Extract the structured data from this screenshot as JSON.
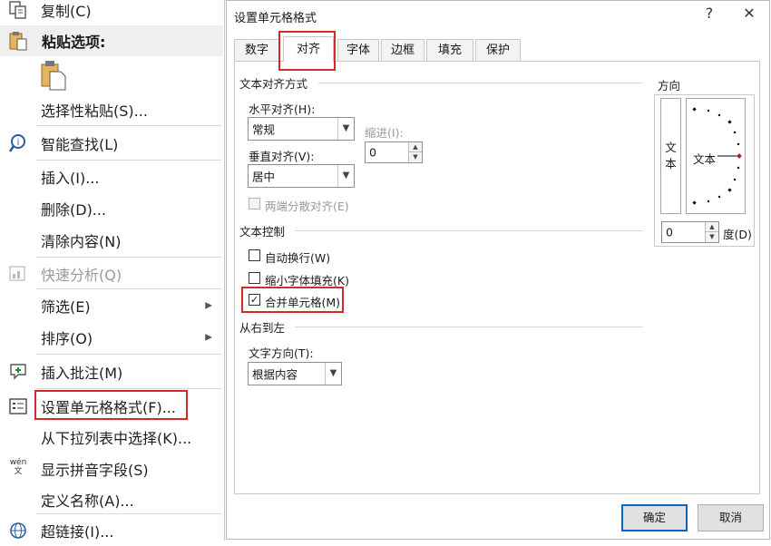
{
  "context_menu": {
    "copy": "复制(C)",
    "paste_options": "粘贴选项:",
    "paste_special": "选择性粘贴(S)...",
    "smart_lookup": "智能查找(L)",
    "insert": "插入(I)...",
    "delete": "删除(D)...",
    "clear_contents": "清除内容(N)",
    "quick_analysis": "快速分析(Q)",
    "filter": "筛选(E)",
    "sort": "排序(O)",
    "insert_comment": "插入批注(M)",
    "format_cells": "设置单元格格式(F)...",
    "pick_from_list": "从下拉列表中选择(K)...",
    "phonetic": "显示拼音字段(S)",
    "define_name": "定义名称(A)...",
    "hyperlink": "超链接(I)...",
    "phonetic_icon_text": "wén\n文"
  },
  "dialog": {
    "title": "设置单元格格式",
    "help_btn": "?",
    "close_btn": "✕",
    "tabs": [
      "数字",
      "对齐",
      "字体",
      "边框",
      "填充",
      "保护"
    ],
    "active_tab": "对齐",
    "text_alignment": {
      "section": "文本对齐方式",
      "horizontal_label": "水平对齐(H):",
      "horizontal_value": "常规",
      "indent_label": "缩进(I):",
      "indent_value": "0",
      "vertical_label": "垂直对齐(V):",
      "vertical_value": "居中",
      "justify_distributed": "两端分散对齐(E)"
    },
    "text_control": {
      "section": "文本控制",
      "wrap_text": "自动换行(W)",
      "shrink_to_fit": "缩小字体填充(K)",
      "merge_cells": "合并单元格(M)",
      "merge_checked": true
    },
    "rtl": {
      "section": "从右到左",
      "direction_label": "文字方向(T):",
      "direction_value": "根据内容"
    },
    "orientation": {
      "section": "方向",
      "vertical_text": "文\n本",
      "dial_text": "文本",
      "degree_value": "0",
      "degree_label": "度(D)"
    },
    "ok": "确定",
    "cancel": "取消"
  },
  "colors": {
    "highlight_red": "#d22b2b",
    "default_button_border": "#0a64c8",
    "dial_marker": "#b11a1a"
  }
}
